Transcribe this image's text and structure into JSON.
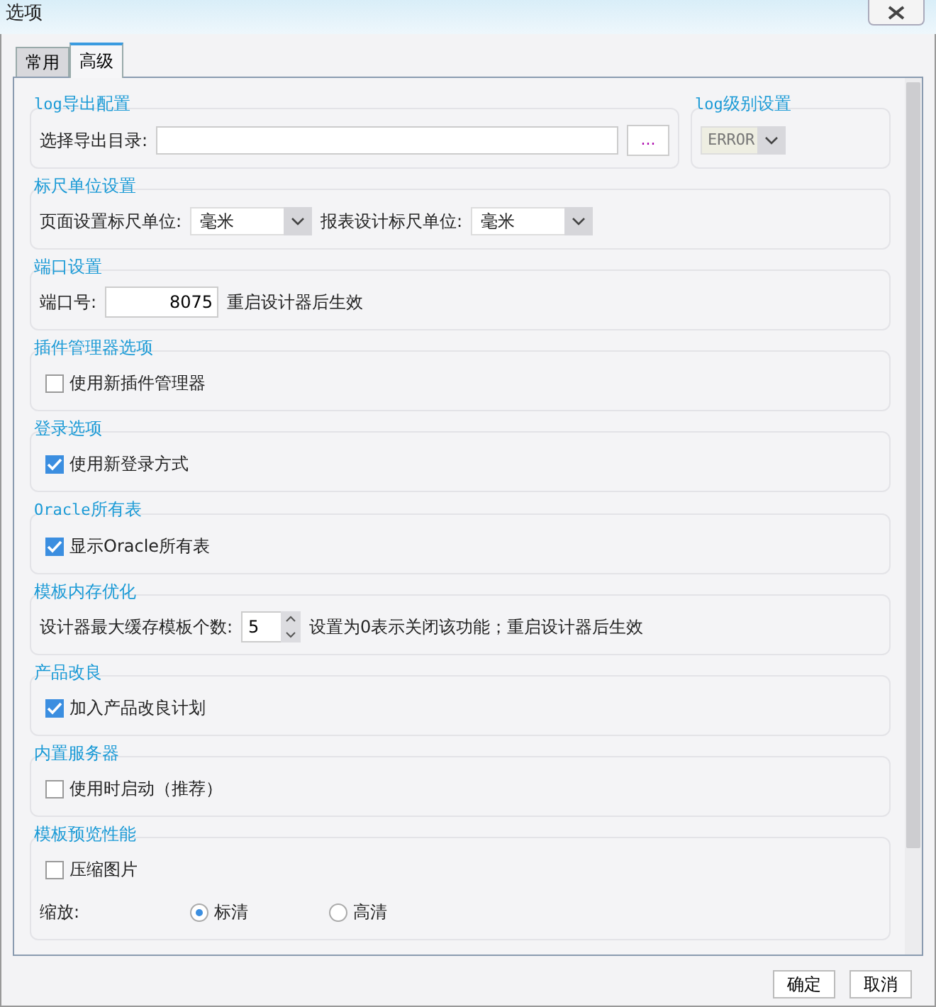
{
  "window": {
    "title": "选项"
  },
  "tabs": [
    {
      "label": "常用",
      "selected": false
    },
    {
      "label": "高级",
      "selected": true
    }
  ],
  "top_row": [
    {
      "title": "log导出配置",
      "lines": [
        [
          {
            "kind": "label",
            "text": "选择导出目录:"
          },
          {
            "kind": "input"
          },
          {
            "kind": "button",
            "text": "..."
          }
        ]
      ]
    },
    {
      "title": "log级别设置",
      "lines": [
        [
          {
            "kind": "select",
            "value": "ERROR",
            "disabled": true
          }
        ]
      ]
    }
  ],
  "sections": [
    {
      "title": "标尺单位设置",
      "lines": [
        [
          {
            "kind": "label",
            "text": "页面设置标尺单位:"
          },
          {
            "kind": "select",
            "value": "毫米",
            "disabled": false
          },
          {
            "kind": "label",
            "text": "报表设计标尺单位:"
          },
          {
            "kind": "select",
            "value": "毫米",
            "disabled": false
          }
        ]
      ]
    },
    {
      "title": "端口设置",
      "lines": [
        [
          {
            "kind": "label",
            "text": "端口号:"
          },
          {
            "kind": "number",
            "value": "8075"
          },
          {
            "kind": "label",
            "text": "重启设计器后生效"
          }
        ]
      ]
    },
    {
      "title": "插件管理器选项",
      "lines": [
        [
          {
            "kind": "checkbox",
            "label": "使用新插件管理器",
            "checked": false
          }
        ]
      ]
    },
    {
      "title": "登录选项",
      "lines": [
        [
          {
            "kind": "checkbox",
            "label": "使用新登录方式",
            "checked": true
          }
        ]
      ]
    },
    {
      "title": "Oracle所有表",
      "lines": [
        [
          {
            "kind": "checkbox",
            "label": "显示Oracle所有表",
            "checked": true
          }
        ]
      ]
    },
    {
      "title": "模板内存优化",
      "lines": [
        [
          {
            "kind": "label",
            "text": "设计器最大缓存模板个数:"
          },
          {
            "kind": "spinner",
            "value": "5"
          },
          {
            "kind": "label",
            "text": "设置为0表示关闭该功能；重启设计器后生效"
          }
        ]
      ]
    },
    {
      "title": "产品改良",
      "lines": [
        [
          {
            "kind": "checkbox",
            "label": "加入产品改良计划",
            "checked": true
          }
        ]
      ]
    },
    {
      "title": "内置服务器",
      "lines": [
        [
          {
            "kind": "checkbox",
            "label": "使用时启动（推荐）",
            "checked": false
          }
        ]
      ]
    },
    {
      "title": "模板预览性能",
      "lines": [
        [
          {
            "kind": "checkbox",
            "label": "压缩图片",
            "checked": false
          }
        ],
        [
          {
            "kind": "label",
            "text": "缩放:"
          },
          {
            "kind": "radio",
            "label": "标清",
            "selected": true
          },
          {
            "kind": "radio",
            "label": "高清",
            "selected": false
          }
        ]
      ]
    }
  ],
  "buttons": [
    "确定",
    "取消"
  ]
}
